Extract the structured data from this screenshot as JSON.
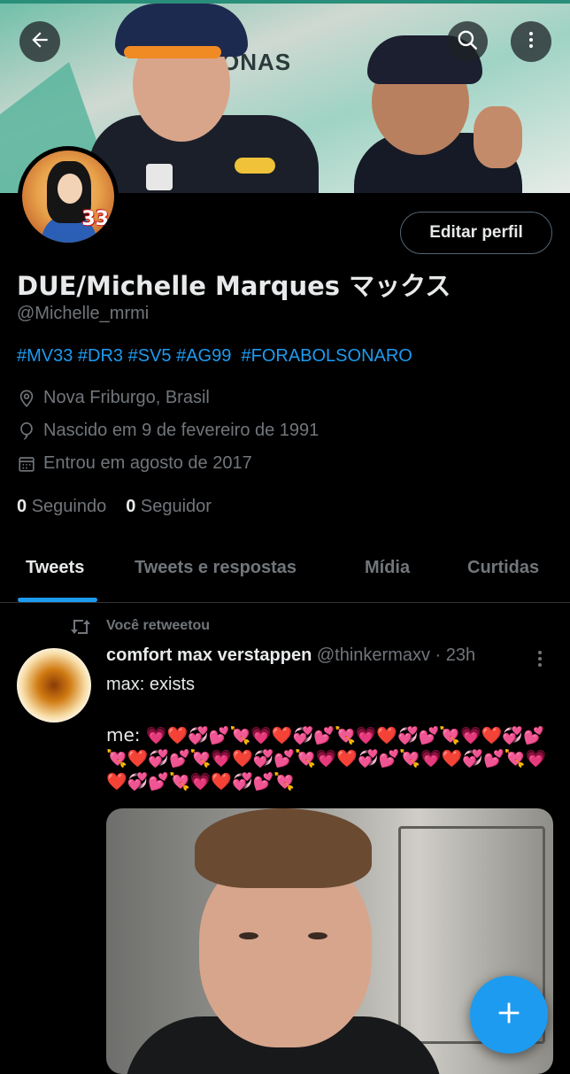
{
  "profile": {
    "display_name": "DUE/Michelle Marques マックス",
    "handle": "@Michelle_mrmi",
    "bio": "#MV33 #DR3 #SV5 #AG99  #FORABOLSONARO",
    "location": "Nova Friburgo, Brasil",
    "birthday": "Nascido em 9 de fevereiro de 1991",
    "joined": "Entrou em agosto de 2017",
    "following_count": "0",
    "following_label": "Seguindo",
    "followers_count": "0",
    "followers_label": "Seguidor",
    "edit_label": "Editar perfil",
    "avatar_number": "33",
    "banner_sign": "ONAS"
  },
  "tabs": [
    {
      "label": "Tweets",
      "active": true
    },
    {
      "label": "Tweets e respostas",
      "active": false
    },
    {
      "label": "Mídia",
      "active": false
    },
    {
      "label": "Curtidas",
      "active": false
    }
  ],
  "tweet": {
    "retweet_label": "Você retweetou",
    "author": "comfort max verstappen",
    "handle": "@thinkermaxv",
    "separator": "·",
    "time": "23h",
    "line1": "max: exists",
    "line2_prefix": "me: "
  },
  "icons": {
    "back": "arrow-left-icon",
    "search": "search-icon",
    "more": "more-vertical-icon",
    "location": "location-pin-icon",
    "birthday": "balloon-icon",
    "calendar": "calendar-icon",
    "retweet": "retweet-icon",
    "compose": "plus-icon"
  },
  "colors": {
    "accent": "#1d9bf0",
    "background": "#000000",
    "muted": "#71767b",
    "text": "#e7e9ea"
  }
}
